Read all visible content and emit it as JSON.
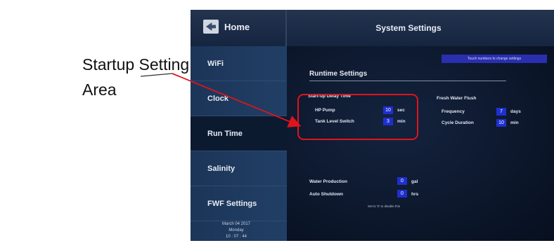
{
  "callout": {
    "line1": "Startup Setting",
    "line2": "Area"
  },
  "header": {
    "home_label": "Home",
    "title": "System Settings"
  },
  "sidebar": {
    "items": [
      {
        "label": "WiFi",
        "active": false
      },
      {
        "label": "Clock",
        "active": false
      },
      {
        "label": "Run Time",
        "active": true
      },
      {
        "label": "Salinity",
        "active": false
      },
      {
        "label": "FWF Settings",
        "active": false
      }
    ],
    "date_line1": "March   04  2017",
    "date_line2": "Monday",
    "date_line3": "10 : 07 : 44"
  },
  "main": {
    "hint": "Touch numbers to change settings",
    "section_title": "Runtime Settings",
    "startup": {
      "title": "Start-up Delay Time",
      "rows": [
        {
          "label": "HP Pump",
          "value": "10",
          "unit": "sec"
        },
        {
          "label": "Tank Level Switch",
          "value": "3",
          "unit": "min"
        }
      ]
    },
    "flush": {
      "title": "Fresh Water Flush",
      "rows": [
        {
          "label": "Frequency",
          "value": "7",
          "unit": "days"
        },
        {
          "label": "Cycle Duration",
          "value": "10",
          "unit": "min"
        }
      ]
    },
    "production": [
      {
        "label": "Water Production",
        "value": "0",
        "unit": "gal"
      },
      {
        "label": "Auto Shutdown",
        "value": "0",
        "unit": "hrs"
      }
    ],
    "note": "Set to '0' to disable this"
  },
  "colors": {
    "highlight": "#e0141c",
    "value_box": "#1f2fd0",
    "hint_bar": "#2a2fb0"
  }
}
